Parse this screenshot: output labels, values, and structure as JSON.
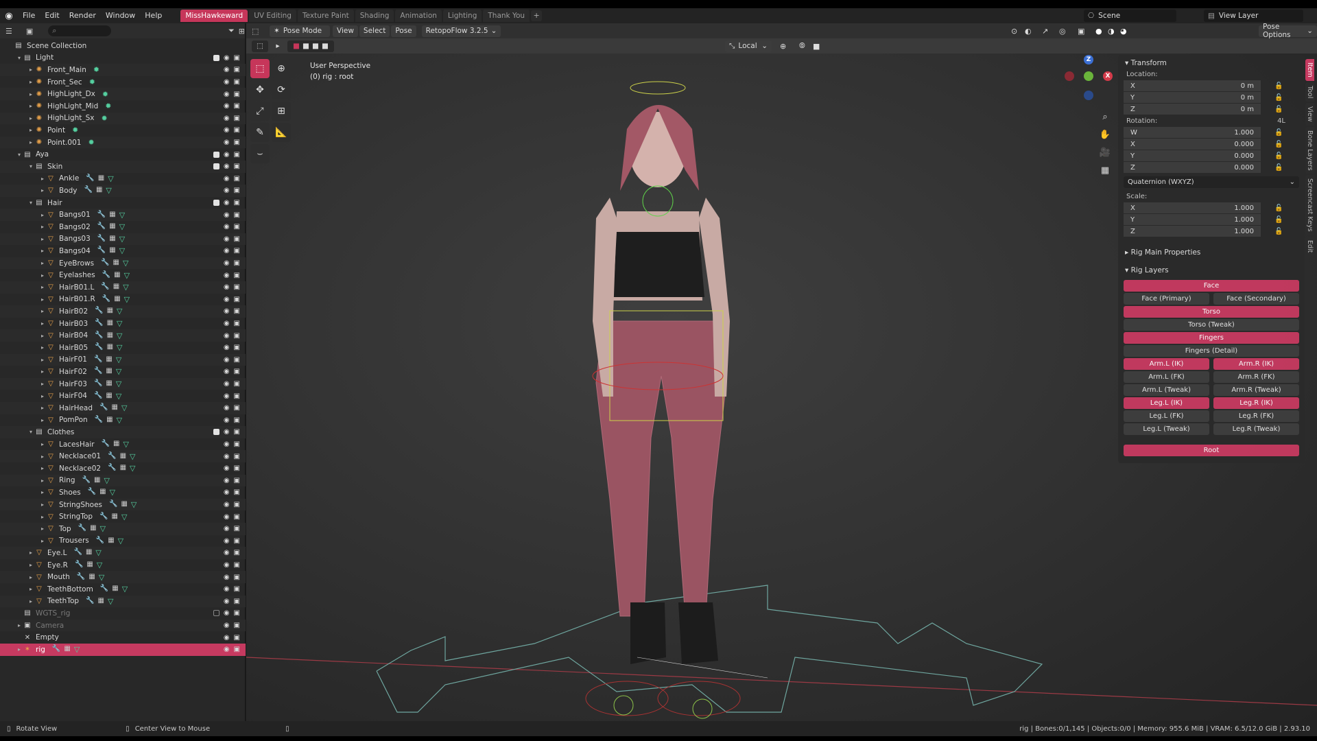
{
  "menubar": {
    "items": [
      "File",
      "Edit",
      "Render",
      "Window",
      "Help"
    ],
    "workspaces": [
      "MissHawkeward",
      "UV Editing",
      "Texture Paint",
      "Shading",
      "Animation",
      "Lighting",
      "Thank You"
    ],
    "active_workspace": "MissHawkeward",
    "scene": "Scene",
    "view_layer": "View Layer"
  },
  "outliner": {
    "root": "Scene Collection",
    "rows": [
      {
        "label": "Light",
        "kind": "collection",
        "depth": 1,
        "arrow": "▾",
        "check": true
      },
      {
        "label": "Front_Main",
        "kind": "light",
        "depth": 2,
        "arrow": "▸"
      },
      {
        "label": "Front_Sec",
        "kind": "light",
        "depth": 2,
        "arrow": "▸"
      },
      {
        "label": "HighLight_Dx",
        "kind": "light",
        "depth": 2,
        "arrow": "▸"
      },
      {
        "label": "HighLight_Mid",
        "kind": "light",
        "depth": 2,
        "arrow": "▸"
      },
      {
        "label": "HighLight_Sx",
        "kind": "light",
        "depth": 2,
        "arrow": "▸"
      },
      {
        "label": "Point",
        "kind": "light",
        "depth": 2,
        "arrow": "▸"
      },
      {
        "label": "Point.001",
        "kind": "light",
        "depth": 2,
        "arrow": "▸"
      },
      {
        "label": "Aya",
        "kind": "collection",
        "depth": 1,
        "arrow": "▾",
        "check": true
      },
      {
        "label": "Skin",
        "kind": "collection",
        "depth": 2,
        "arrow": "▾",
        "check": true
      },
      {
        "label": "Ankle",
        "kind": "mesh",
        "depth": 3,
        "arrow": "▸"
      },
      {
        "label": "Body",
        "kind": "mesh",
        "depth": 3,
        "arrow": "▸"
      },
      {
        "label": "Hair",
        "kind": "collection",
        "depth": 2,
        "arrow": "▾",
        "check": true
      },
      {
        "label": "Bangs01",
        "kind": "mesh",
        "depth": 3,
        "arrow": "▸"
      },
      {
        "label": "Bangs02",
        "kind": "mesh",
        "depth": 3,
        "arrow": "▸"
      },
      {
        "label": "Bangs03",
        "kind": "mesh",
        "depth": 3,
        "arrow": "▸"
      },
      {
        "label": "Bangs04",
        "kind": "mesh",
        "depth": 3,
        "arrow": "▸"
      },
      {
        "label": "EyeBrows",
        "kind": "mesh",
        "depth": 3,
        "arrow": "▸"
      },
      {
        "label": "Eyelashes",
        "kind": "mesh",
        "depth": 3,
        "arrow": "▸"
      },
      {
        "label": "HairB01.L",
        "kind": "mesh",
        "depth": 3,
        "arrow": "▸"
      },
      {
        "label": "HairB01.R",
        "kind": "mesh",
        "depth": 3,
        "arrow": "▸"
      },
      {
        "label": "HairB02",
        "kind": "mesh",
        "depth": 3,
        "arrow": "▸"
      },
      {
        "label": "HairB03",
        "kind": "mesh",
        "depth": 3,
        "arrow": "▸"
      },
      {
        "label": "HairB04",
        "kind": "mesh",
        "depth": 3,
        "arrow": "▸"
      },
      {
        "label": "HairB05",
        "kind": "mesh",
        "depth": 3,
        "arrow": "▸"
      },
      {
        "label": "HairF01",
        "kind": "mesh",
        "depth": 3,
        "arrow": "▸"
      },
      {
        "label": "HairF02",
        "kind": "mesh",
        "depth": 3,
        "arrow": "▸"
      },
      {
        "label": "HairF03",
        "kind": "mesh",
        "depth": 3,
        "arrow": "▸"
      },
      {
        "label": "HairF04",
        "kind": "mesh",
        "depth": 3,
        "arrow": "▸"
      },
      {
        "label": "HairHead",
        "kind": "mesh",
        "depth": 3,
        "arrow": "▸"
      },
      {
        "label": "PomPon",
        "kind": "mesh",
        "depth": 3,
        "arrow": "▸"
      },
      {
        "label": "Clothes",
        "kind": "collection",
        "depth": 2,
        "arrow": "▾",
        "check": true
      },
      {
        "label": "LacesHair",
        "kind": "mesh",
        "depth": 3,
        "arrow": "▸"
      },
      {
        "label": "Necklace01",
        "kind": "mesh",
        "depth": 3,
        "arrow": "▸"
      },
      {
        "label": "Necklace02",
        "kind": "mesh",
        "depth": 3,
        "arrow": "▸"
      },
      {
        "label": "Ring",
        "kind": "mesh",
        "depth": 3,
        "arrow": "▸"
      },
      {
        "label": "Shoes",
        "kind": "mesh",
        "depth": 3,
        "arrow": "▸"
      },
      {
        "label": "StringShoes",
        "kind": "mesh",
        "depth": 3,
        "arrow": "▸"
      },
      {
        "label": "StringTop",
        "kind": "mesh",
        "depth": 3,
        "arrow": "▸"
      },
      {
        "label": "Top",
        "kind": "mesh",
        "depth": 3,
        "arrow": "▸"
      },
      {
        "label": "Trousers",
        "kind": "mesh",
        "depth": 3,
        "arrow": "▸"
      },
      {
        "label": "Eye.L",
        "kind": "mesh",
        "depth": 2,
        "arrow": "▸"
      },
      {
        "label": "Eye.R",
        "kind": "mesh",
        "depth": 2,
        "arrow": "▸"
      },
      {
        "label": "Mouth",
        "kind": "mesh",
        "depth": 2,
        "arrow": "▸"
      },
      {
        "label": "TeethBottom",
        "kind": "mesh",
        "depth": 2,
        "arrow": "▸"
      },
      {
        "label": "TeethTop",
        "kind": "mesh",
        "depth": 2,
        "arrow": "▸"
      },
      {
        "label": "WGTS_rig",
        "kind": "collection",
        "depth": 1,
        "arrow": "",
        "check": false,
        "dim": true
      },
      {
        "label": "Camera",
        "kind": "camera",
        "depth": 1,
        "arrow": "▸",
        "dim": true
      },
      {
        "label": "Empty",
        "kind": "empty",
        "depth": 1,
        "arrow": ""
      },
      {
        "label": "rig",
        "kind": "armature",
        "depth": 1,
        "arrow": "▸",
        "selected": true
      }
    ]
  },
  "viewport": {
    "mode": "Pose Mode",
    "menus": [
      "View",
      "Select",
      "Pose"
    ],
    "addon": "RetopoFlow 3.2.5",
    "transform_orientation": "Local",
    "pose_options": "Pose Options",
    "info_line1": "User Perspective",
    "info_line2": "(0) rig : root"
  },
  "npanel": {
    "transform_title": "Transform",
    "location_label": "Location:",
    "location": [
      {
        "axis": "X",
        "value": "0 m"
      },
      {
        "axis": "Y",
        "value": "0 m"
      },
      {
        "axis": "Z",
        "value": "0 m"
      }
    ],
    "rotation_label": "Rotation:",
    "rotation_mode_short": "4L",
    "rotation": [
      {
        "axis": "W",
        "value": "1.000"
      },
      {
        "axis": "X",
        "value": "0.000"
      },
      {
        "axis": "Y",
        "value": "0.000"
      },
      {
        "axis": "Z",
        "value": "0.000"
      }
    ],
    "rotation_mode": "Quaternion (WXYZ)",
    "scale_label": "Scale:",
    "scale": [
      {
        "axis": "X",
        "value": "1.000"
      },
      {
        "axis": "Y",
        "value": "1.000"
      },
      {
        "axis": "Z",
        "value": "1.000"
      }
    ],
    "rig_main": "Rig Main Properties",
    "rig_layers": "Rig Layers",
    "layers_full": [
      {
        "label": "Face",
        "on": true
      },
      {
        "pair": [
          {
            "label": "Face (Primary)",
            "on": false
          },
          {
            "label": "Face (Secondary)",
            "on": false
          }
        ]
      },
      {
        "label": "Torso",
        "on": true
      },
      {
        "label": "Torso (Tweak)",
        "on": false
      },
      {
        "label": "Fingers",
        "on": true
      },
      {
        "label": "Fingers (Detail)",
        "on": false
      },
      {
        "pair": [
          {
            "label": "Arm.L (IK)",
            "on": true
          },
          {
            "label": "Arm.R (IK)",
            "on": true
          }
        ]
      },
      {
        "pair": [
          {
            "label": "Arm.L (FK)",
            "on": false
          },
          {
            "label": "Arm.R (FK)",
            "on": false
          }
        ]
      },
      {
        "pair": [
          {
            "label": "Arm.L (Tweak)",
            "on": false
          },
          {
            "label": "Arm.R (Tweak)",
            "on": false
          }
        ]
      },
      {
        "pair": [
          {
            "label": "Leg.L (IK)",
            "on": true
          },
          {
            "label": "Leg.R (IK)",
            "on": true
          }
        ]
      },
      {
        "pair": [
          {
            "label": "Leg.L (FK)",
            "on": false
          },
          {
            "label": "Leg.R (FK)",
            "on": false
          }
        ]
      },
      {
        "pair": [
          {
            "label": "Leg.L (Tweak)",
            "on": false
          },
          {
            "label": "Leg.R (Tweak)",
            "on": false
          }
        ]
      }
    ],
    "root_label": "Root",
    "tabs": [
      "Item",
      "Tool",
      "View",
      "Bone Layers",
      "Screencast Keys",
      "Edit"
    ]
  },
  "statusbar": {
    "left": "Rotate View",
    "middle": "Center View to Mouse",
    "right": "rig | Bones:0/1,145 | Objects:0/0 | Memory: 955.6 MiB | VRAM: 6.5/12.0 GiB | 2.93.10"
  },
  "colors": {
    "accent": "#c63a60",
    "mesh_icon": "#e7a14a",
    "data_icon": "#55d0a0",
    "modifier_icon": "#7aa5ff"
  }
}
